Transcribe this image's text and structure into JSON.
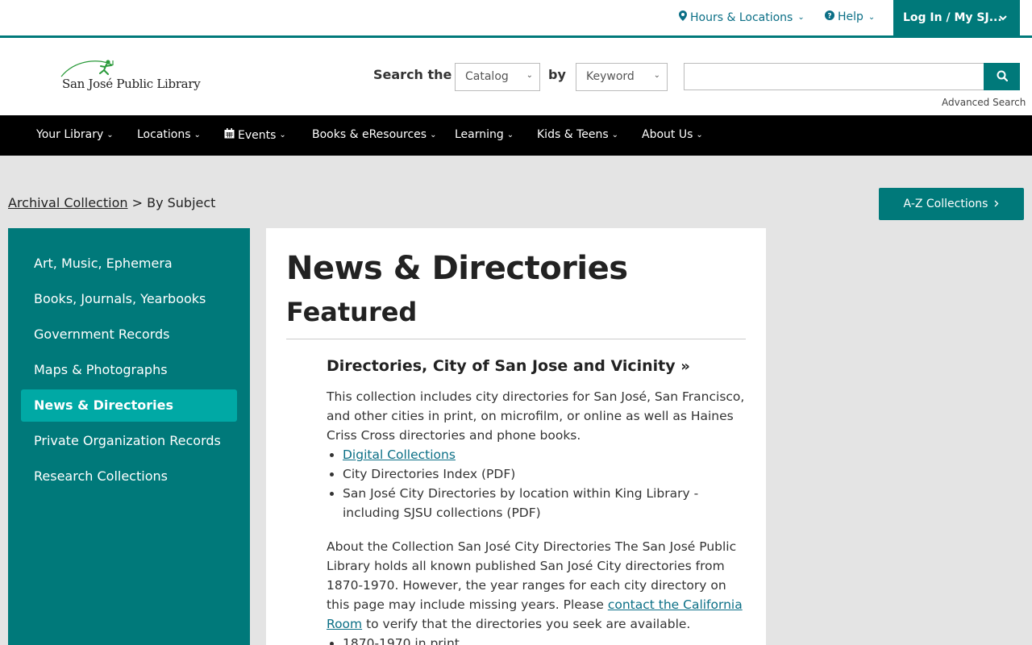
{
  "utility": {
    "hours": "Hours & Locations",
    "help": "Help",
    "login": "Log In / My SJ..."
  },
  "logo": {
    "text": "San José Public Library"
  },
  "search": {
    "label": "Search the",
    "scope": "Catalog",
    "by_label": "by",
    "type": "Keyword",
    "input_value": "",
    "advanced": "Advanced Search"
  },
  "nav": [
    "Your Library",
    "Locations",
    "Events",
    "Books & eResources",
    "Learning",
    "Kids & Teens",
    "About Us"
  ],
  "breadcrumb": {
    "link": "Archival Collection",
    "sep": ">",
    "current": "By Subject"
  },
  "az_button": "A-Z Collections",
  "sidebar": {
    "items": [
      {
        "label": "Art, Music, Ephemera"
      },
      {
        "label": "Books, Journals, Yearbooks"
      },
      {
        "label": "Government Records"
      },
      {
        "label": "Maps & Photographs"
      },
      {
        "label": "News & Directories"
      },
      {
        "label": "Private Organization Records"
      },
      {
        "label": "Research Collections"
      }
    ],
    "active": "News & Directories"
  },
  "content": {
    "title": "News & Directories",
    "featured": "Featured",
    "section_title": "Directories, City of San Jose and Vicinity",
    "description": "This collection includes city directories for San José, San Francisco, and other cities in print, on microfilm, or online as well as Haines Criss Cross directories and phone books.",
    "list": [
      "Digital Collections",
      "City Directories Index (PDF)",
      "San José City Directories by location within King Library - including SJSU collections (PDF)"
    ],
    "about_text_1": "About the Collection San José City Directories The San José Public Library holds all known published San José City directories from 1870-1970. However, the year ranges for each city directory on this page may include missing years. Please ",
    "about_link": "contact the California Room",
    "about_text_2": " to verify that the directories you seek are available.",
    "list2": [
      "1870-1970 in print"
    ]
  },
  "colors": {
    "teal": "#00797a",
    "teal_active": "#00a9a5",
    "link": "#0b6f86"
  }
}
